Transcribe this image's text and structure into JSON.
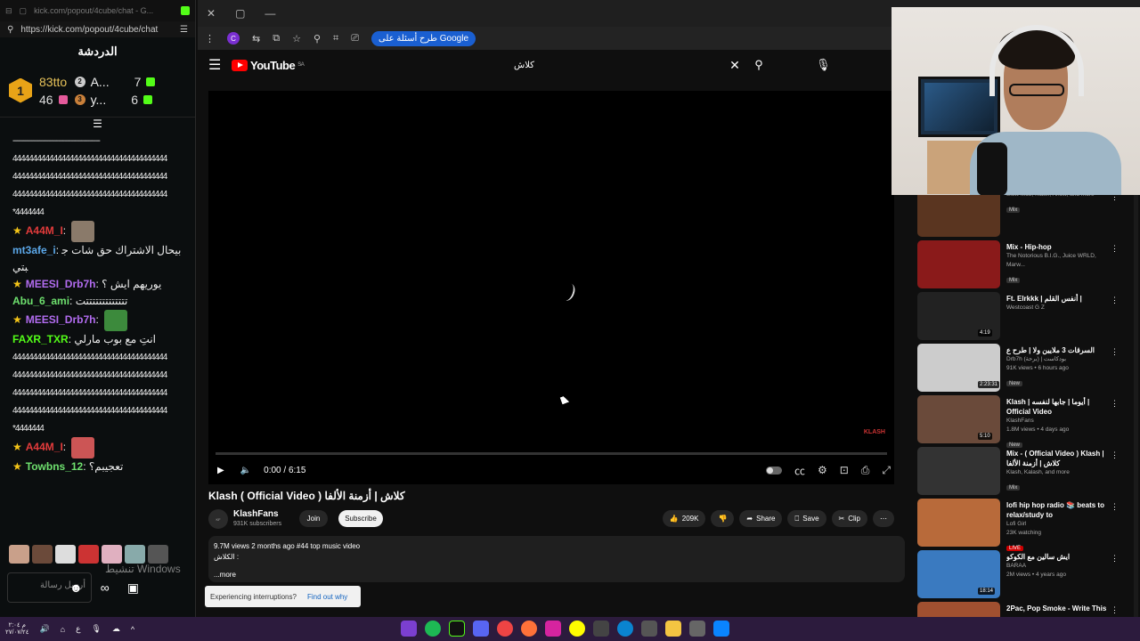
{
  "chat": {
    "tab_url": "kick.com/popout/4cube/chat - G...",
    "url": "https://kick.com/popout/4cube/chat",
    "title": "الدردشة",
    "leaderboard": [
      {
        "rank": "1",
        "user": "83tto",
        "count": "46"
      },
      {
        "rank": "2",
        "user": "A...",
        "count": "7"
      },
      {
        "rank": "3",
        "user": "y...",
        "count": "6"
      }
    ],
    "messages": [
      {
        "type": "spam",
        "text": "------------------------------------------"
      },
      {
        "type": "spam",
        "text": "44444444444444444444444444444444444444"
      },
      {
        "type": "spam",
        "text": "44444444444444444444444444444444444444"
      },
      {
        "type": "spam",
        "text": "44444444444444444444444444444444444444"
      },
      {
        "type": "spam",
        "text": "*4444444"
      },
      {
        "type": "user",
        "user": "A44M_I",
        "color": "#e23b3b",
        "star": true,
        "text": "",
        "emote": "#8a7a6a"
      },
      {
        "type": "user",
        "user": "mt3afe_i",
        "color": "#5ba7e8",
        "star": false,
        "text": "بيحال الاشتراك حق شات جبتي"
      },
      {
        "type": "user",
        "user": "MEESI_Drb7h",
        "color": "#b26cf0",
        "star": true,
        "text": "يوريهم ايش ؟"
      },
      {
        "type": "user",
        "user": "Abu_6_ami",
        "color": "#6ee06e",
        "star": false,
        "text": "تتتتتتتتتتتتتت"
      },
      {
        "type": "user",
        "user": "MEESI_Drb7h",
        "color": "#b26cf0",
        "star": true,
        "text": "",
        "emote": "#3c8a3c"
      },
      {
        "type": "user",
        "user": "FAXR_TXR",
        "color": "#53fc18",
        "star": false,
        "text": "انتِ مع بوب مارلي"
      },
      {
        "type": "spam",
        "text": "44444444444444444444444444444444444444"
      },
      {
        "type": "spam",
        "text": "44444444444444444444444444444444444444"
      },
      {
        "type": "spam",
        "text": "44444444444444444444444444444444444444"
      },
      {
        "type": "spam",
        "text": "44444444444444444444444444444444444444"
      },
      {
        "type": "spam",
        "text": "*4444444"
      },
      {
        "type": "user",
        "user": "A44M_I",
        "color": "#e23b3b",
        "star": true,
        "text": "",
        "emote": "#c55"
      },
      {
        "type": "user",
        "user": "Towbns_12",
        "color": "#6ee06e",
        "star": true,
        "text": "تعجيبم؟"
      }
    ],
    "input_placeholder": "أرسل رسالة",
    "windows_watermark": "تنشيط Windows"
  },
  "browser": {
    "ask_google": "طرح أسئلة على Google"
  },
  "youtube": {
    "logo": "YouTube",
    "region": "SA",
    "search_query": "كلاش",
    "time": "0:00 / 6:15",
    "watermark": "KLASH",
    "title": "Klash ( Official Video ) كلاش | أزمنة الألفا",
    "channel": "KlashFans",
    "subscribers": "931K subscribers",
    "join": "Join",
    "subscribe": "Subscribe",
    "likes": "209K",
    "share": "Share",
    "save": "Save",
    "clip": "Clip",
    "desc_meta": "9.7M views  2 months ago  #44 top music video",
    "desc_line": "الكلاش :",
    "more": "...more",
    "interrupt_text": "Experiencing interruptions?",
    "interrupt_link": "Find out why"
  },
  "recs": [
    {
      "title": "",
      "meta": "Slow Mo8, Klash, Arlow, and more",
      "badge": "Mix",
      "dur": "",
      "thumb": "#5a3520"
    },
    {
      "title": "Mix - Hip-hop",
      "meta": "The Notorious B.I.G., Juice WRLD, Marw...",
      "badge": "Mix",
      "dur": "",
      "thumb": "#8a1a1a"
    },
    {
      "title": "Ft. Elrkkk | أنفس القلم |",
      "meta": "Westcoast G Z",
      "badge": "",
      "dur": "4:19",
      "thumb": "#222"
    },
    {
      "title": "السرقات 3 ملايين ولا | طرح ع",
      "meta": "Drb7h بودكاست | (برحة)",
      "badge": "New",
      "dur": "2:23:31",
      "thumb": "#ccc",
      "extra": "91K views • 6 hours ago"
    },
    {
      "title": "Klash | أيوما | جابها لنفسه | Official Video",
      "meta": "KlashFans",
      "badge": "New",
      "dur": "5:10",
      "thumb": "#6a4a3a",
      "extra": "1.8M views • 4 days ago"
    },
    {
      "title": "Mix - ( Official Video ) Klash | كلاش | أزمنة الألفا",
      "meta": "Klash, Kalash, and more",
      "badge": "Mix",
      "dur": "",
      "thumb": "#333"
    },
    {
      "title": "lofi hip hop radio 📚 beats to relax/study to",
      "meta": "Lofi Girl",
      "badge": "LIVE",
      "dur": "",
      "thumb": "#b86a3a",
      "extra": "23K watching"
    },
    {
      "title": "ايش سالين مع الكوكو",
      "meta": "BARAA",
      "badge": "",
      "dur": "18:14",
      "thumb": "#3a7ac0",
      "extra": "2M views • 4 years ago"
    },
    {
      "title": "2Pac, Pop Smoke - Write This",
      "meta": "",
      "badge": "",
      "dur": "",
      "thumb": "#a05030"
    }
  ],
  "taskbar": {
    "time": "م ٢:٠٤",
    "date": "٢٧/٠٧/٢٤"
  }
}
